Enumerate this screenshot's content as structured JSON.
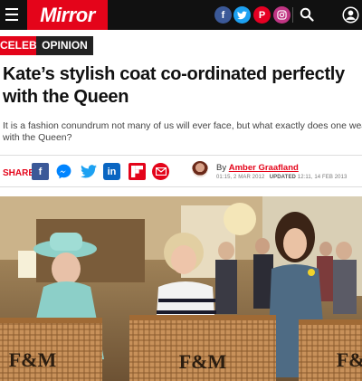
{
  "header": {
    "brand": "Mirror",
    "social": [
      {
        "name": "facebook",
        "glyph": "f"
      },
      {
        "name": "twitter",
        "glyph": "t"
      },
      {
        "name": "pinterest",
        "glyph": "P"
      },
      {
        "name": "instagram",
        "glyph": "◎"
      }
    ]
  },
  "tags": {
    "primary": "CELEBS",
    "secondary": "OPINION"
  },
  "article": {
    "headline": "Kate’s stylish coat co-ordinated perfectly with the Queen",
    "standfirst_line1": "It is a fashion conundrum not many of us will ever face, but what exactly does one wear for tea",
    "standfirst_line2": "with the Queen?",
    "byline_prefix": "By",
    "author": "Amber Graafland",
    "published": "01:15, 2 MAR 2012",
    "updated_label": "UPDATED",
    "updated": "12:11, 14 FEB 2013"
  },
  "share": {
    "label": "SHARE",
    "icons": [
      "facebook",
      "messenger",
      "twitter",
      "linkedin",
      "flipboard",
      "email"
    ]
  },
  "photo": {
    "basket_text": "F&M"
  },
  "colors": {
    "brand_red": "#e4041a",
    "topbar": "#111111"
  }
}
